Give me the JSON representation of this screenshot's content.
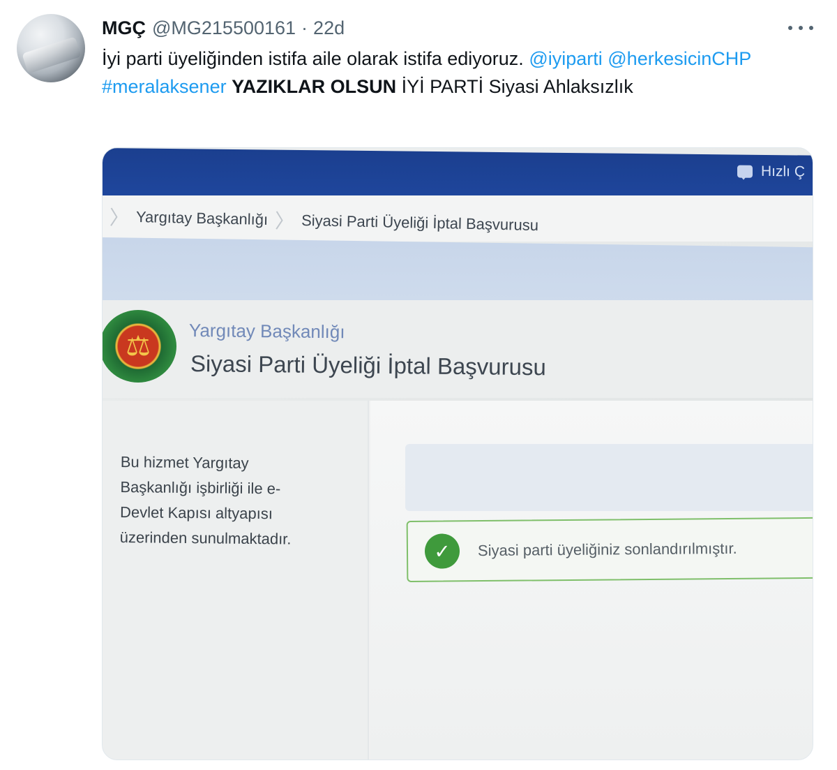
{
  "tweet": {
    "author_name": "MGÇ",
    "handle": "@MG215500161",
    "separator": "·",
    "time": "22d",
    "text_intro": "İyi parti üyeliğinden istifa aile olarak istifa ediyoruz. ",
    "mention_1": "@iyiparti",
    "mention_2": "@herkesicinCHP",
    "hashtag": "#meralaksener",
    "bold_text": "YAZIKLAR OLSUN",
    "text_outro": " İYİ PARTİ Siyasi Ahlaksızlık"
  },
  "photo": {
    "quick_label": "Hızlı Ç",
    "breadcrumb": [
      "Yargıtay Başkanlığı",
      "Siyasi Parti Üyeliği İptal Başvurusu"
    ],
    "breadcrumb_sep": "〉",
    "org_title": "Yargıtay Başkanlığı",
    "service_title": "Siyasi Parti Üyeliği İptal Başvurusu",
    "info_text": "Bu hizmet Yargıtay Başkanlığı işbirliği ile e-Devlet Kapısı altyapısı üzerinden sunulmaktadır.",
    "success_message": "Siyasi parti üyeliğiniz sonlandırılmıştır.",
    "check_glyph": "✓"
  },
  "colors": {
    "link": "#1d9bf0",
    "text": "#0f1419",
    "muted": "#536471",
    "portal_blue": "#2049a2",
    "success_green": "#3f9a3c"
  }
}
